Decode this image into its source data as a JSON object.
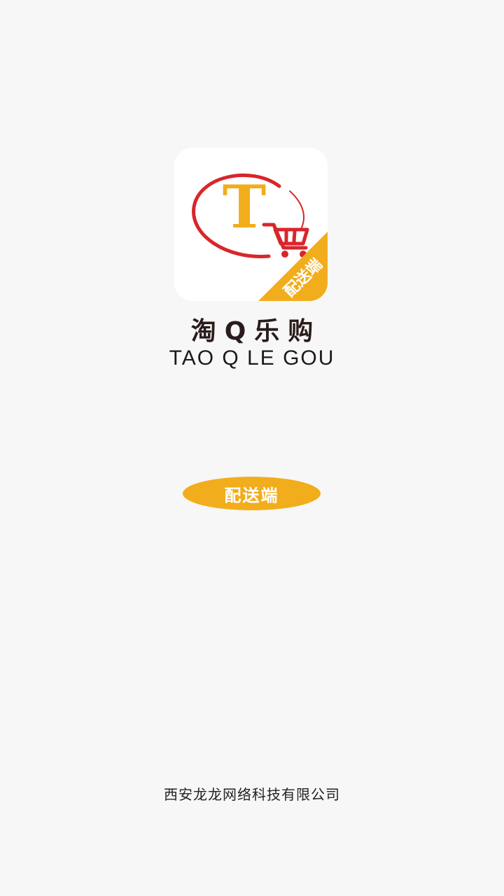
{
  "logo": {
    "letter": "T",
    "ribbon_text": "配送端",
    "colors": {
      "ring": "#d8262b",
      "letter": "#f2ad1c",
      "cart": "#d8262b",
      "ribbon": "#f2ad1c"
    }
  },
  "brand": {
    "name_cn": "淘Q乐购",
    "name_en": "TAO Q LE GOU"
  },
  "role_button": {
    "label": "配送端",
    "color": "#f2ad1c"
  },
  "footer": {
    "company": "西安龙龙网络科技有限公司"
  }
}
